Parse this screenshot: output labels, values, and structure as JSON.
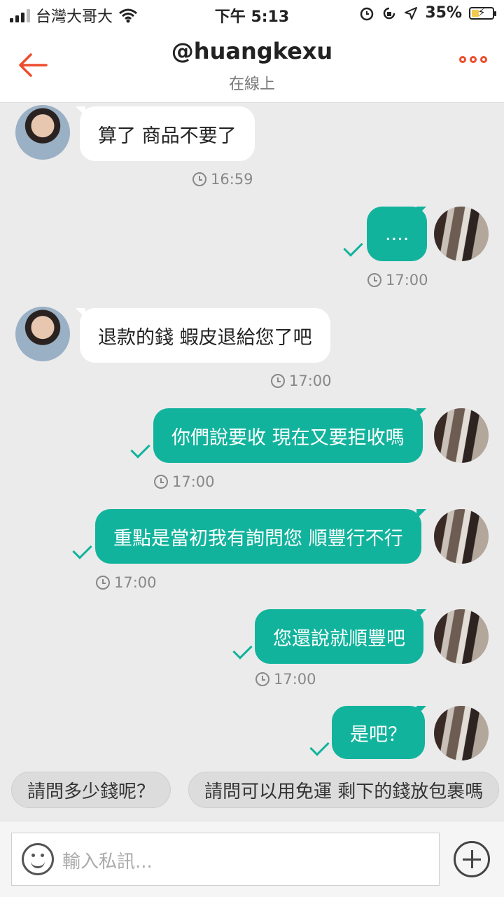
{
  "status_bar": {
    "carrier": "台灣大哥大",
    "time": "下午 5:13",
    "battery": "35%",
    "battery_level": 0.35
  },
  "header": {
    "title": "@huangkexu",
    "subtitle": "在線上"
  },
  "messages": [
    {
      "from": "other",
      "text": "算了 商品不要了",
      "time": "16:59"
    },
    {
      "from": "self",
      "text": "....",
      "time": "17:00"
    },
    {
      "from": "other",
      "text": "退款的錢 蝦皮退給您了吧",
      "time": "17:00"
    },
    {
      "from": "self",
      "text": "你們說要收 現在又要拒收嗎",
      "time": "17:00"
    },
    {
      "from": "self",
      "text": "重點是當初我有詢問您 順豐行不行",
      "time": "17:00"
    },
    {
      "from": "self",
      "text": "您還說就順豐吧",
      "time": "17:00"
    },
    {
      "from": "self",
      "text": "是吧？",
      "time": ""
    }
  ],
  "quick_replies": [
    "請問多少錢呢？",
    "請問可以用免運 剩下的錢放包裹嗎"
  ],
  "input": {
    "placeholder": "輸入私訊..."
  },
  "colors": {
    "accent": "#ee4d2d",
    "bubble_self": "#12b39c",
    "bubble_other": "#ffffff",
    "background": "#ebebeb"
  },
  "icons": [
    "signal-icon",
    "wifi-icon",
    "alarm-icon",
    "rotation-lock-icon",
    "location-icon",
    "battery-icon",
    "back-arrow-icon",
    "more-icon",
    "clock-icon",
    "check-icon",
    "emoji-icon",
    "plus-icon"
  ]
}
